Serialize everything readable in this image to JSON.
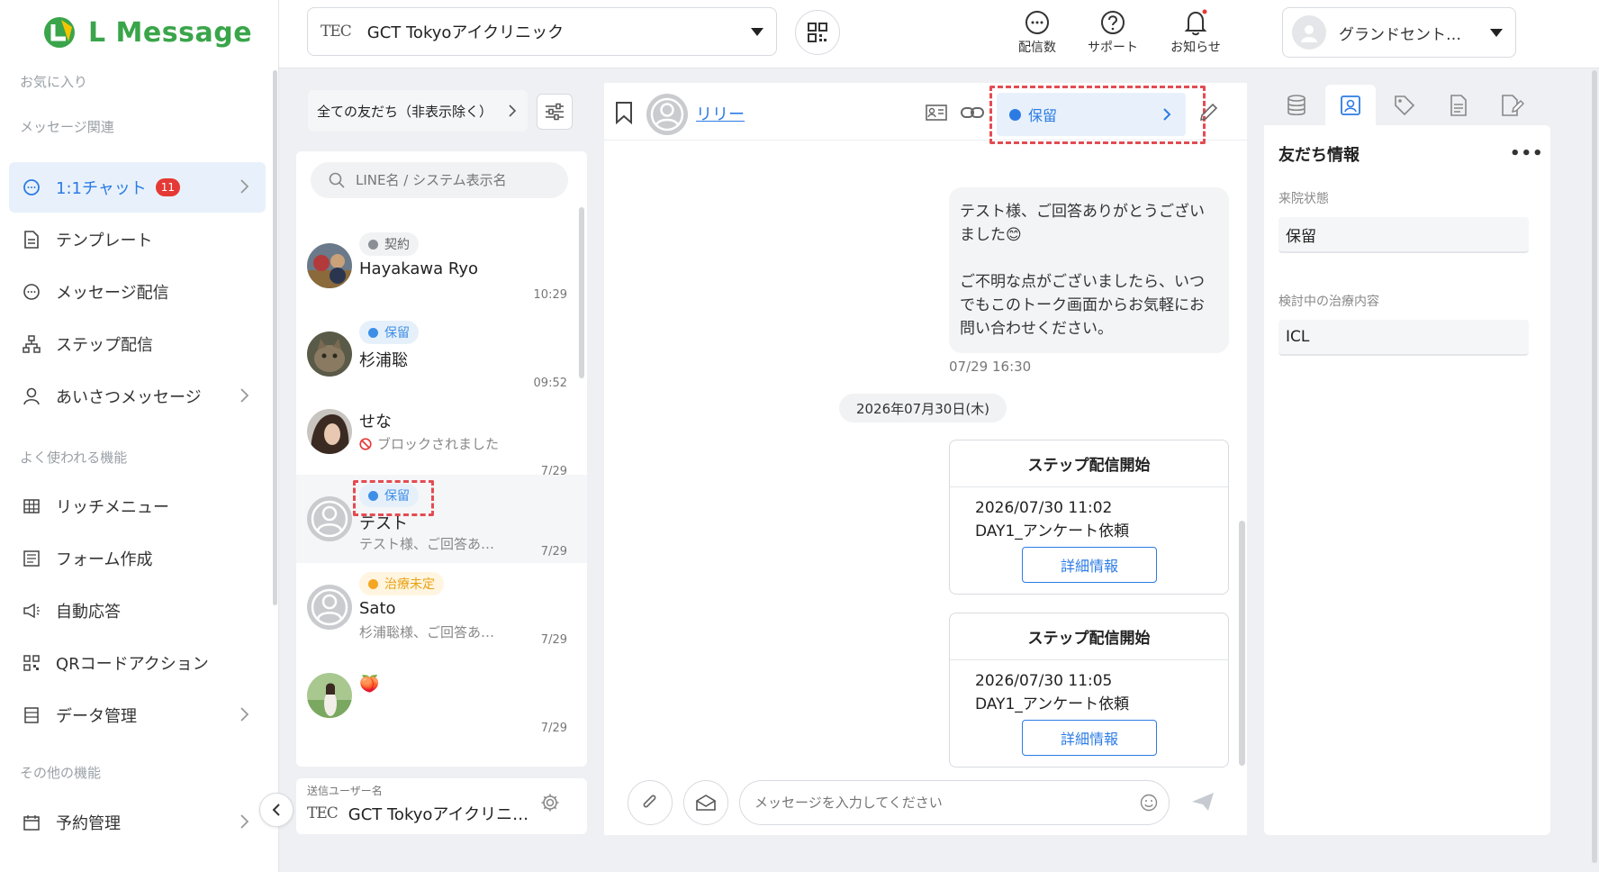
{
  "app": {
    "name": "L Message"
  },
  "sidebar": {
    "sections": {
      "favorites": "お気に入り",
      "messages": "メッセージ関連",
      "frequent": "よく使われる機能",
      "other": "その他の機能"
    },
    "items": [
      {
        "label": "1:1チャット",
        "badge": "11"
      },
      {
        "label": "テンプレート"
      },
      {
        "label": "メッセージ配信"
      },
      {
        "label": "ステップ配信"
      },
      {
        "label": "あいさつメッセージ"
      },
      {
        "label": "リッチメニュー"
      },
      {
        "label": "フォーム作成"
      },
      {
        "label": "自動応答"
      },
      {
        "label": "QRコードアクション"
      },
      {
        "label": "データ管理"
      },
      {
        "label": "予約管理"
      }
    ]
  },
  "header": {
    "clinic_logo": "TEC",
    "clinic_name": "GCT Tokyoアイクリニック",
    "broadcast_count_label": "配信数",
    "support_label": "サポート",
    "notifications_label": "お知らせ",
    "account_name": "グランドセント…"
  },
  "friends": {
    "filter_label": "全ての友だち（非表示除く）",
    "search_placeholder": "LINE名 / システム表示名",
    "list": [
      {
        "tag": "契約",
        "name": "Hayakawa Ryo",
        "sub": "",
        "time": "10:29"
      },
      {
        "tag": "保留",
        "name": "杉浦聡",
        "sub": "",
        "time": "09:52"
      },
      {
        "tag": "",
        "name": "せな",
        "sub": "ブロックされました",
        "time": "7/29"
      },
      {
        "tag": "保留",
        "name": "テスト",
        "sub": "テスト様、ご回答あ…",
        "time": "7/29"
      },
      {
        "tag": "治療未定",
        "name": "Sato",
        "sub": "杉浦聡様、ご回答あ…",
        "time": "7/29"
      },
      {
        "tag": "",
        "name": "🍑",
        "sub": "",
        "time": "7/29"
      }
    ],
    "sender_label": "送信ユーザー名",
    "sender_logo": "TEC",
    "sender_name": "GCT Tokyoアイクリニ…"
  },
  "chat": {
    "contact_name": "リリー",
    "status": "保留",
    "message_text": "テスト様、ご回答ありがとうございました😊\n\nご不明な点がございましたら、いつでもこのトーク画面からお気軽にお問い合わせください。",
    "message_time": "07/29 16:30",
    "date_divider": "2026年07月30日(木)",
    "steps": [
      {
        "title": "ステップ配信開始",
        "datetime": "2026/07/30 11:02",
        "name": "DAY1_アンケート依頼",
        "button": "詳細情報"
      },
      {
        "title": "ステップ配信開始",
        "datetime": "2026/07/30 11:05",
        "name": "DAY1_アンケート依頼",
        "button": "詳細情報"
      }
    ],
    "composer_placeholder": "メッセージを入力してください"
  },
  "info": {
    "title": "友だち情報",
    "more": "•••",
    "fields": [
      {
        "label": "来院状態",
        "value": "保留"
      },
      {
        "label": "検討中の治療内容",
        "value": "ICL"
      }
    ]
  },
  "colors": {
    "accent": "#2c7be5",
    "brand": "#3aa54a",
    "highlight": "#e34c52",
    "badge": "#e53935"
  }
}
